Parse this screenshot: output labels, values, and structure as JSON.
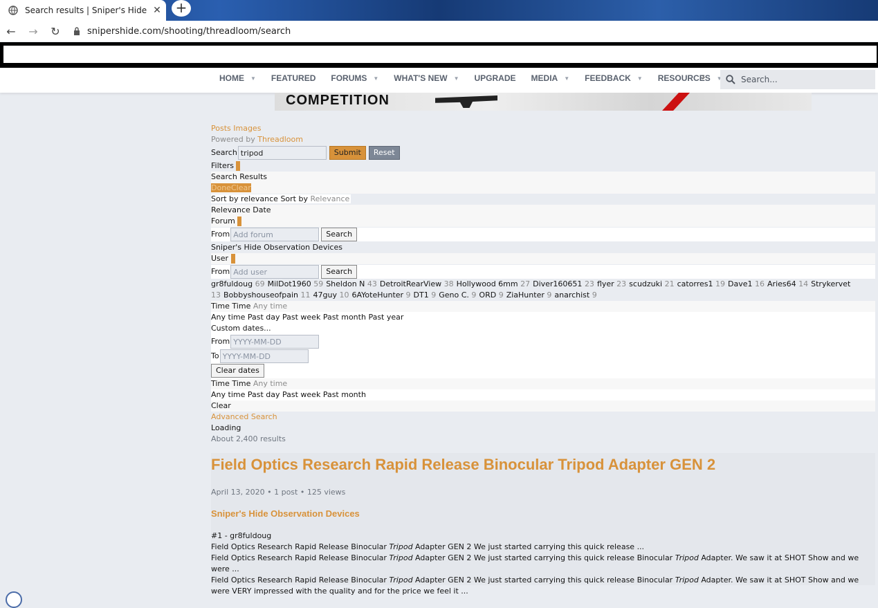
{
  "browser": {
    "tab_title": "Search results | Sniper's Hide For",
    "tab_close": "✕",
    "new_tab": "+",
    "url": "snipershide.com/shooting/threadloom/search"
  },
  "nav": {
    "items": [
      "HOME",
      "FEATURED",
      "FORUMS",
      "WHAT'S NEW",
      "UPGRADE",
      "MEDIA",
      "FEEDBACK",
      "RESOURCES"
    ],
    "more": "›",
    "search_placeholder": "Search..."
  },
  "banner": {
    "text": "COMPETITION"
  },
  "search": {
    "tabs": "Posts Images",
    "powered_prefix": "Powered by ",
    "powered_link": "Threadloom",
    "search_label": "Search",
    "query": "tripod",
    "submit": "Submit",
    "reset": "Reset",
    "filters": "Filters",
    "results_label": "Search Results",
    "done": "Done",
    "clear": "Clear",
    "sort_text": "Sort by relevance Sort by ",
    "sort_value": "Relevance",
    "sort_options": "Relevance Date",
    "forum_label": "Forum",
    "from_label": "From",
    "add_forum_placeholder": "Add forum",
    "search_btn": "Search",
    "forum_selected": "Sniper's Hide Observation Devices",
    "user_label": "User",
    "add_user_placeholder": "Add user",
    "users": [
      {
        "name": "gr8fuldoug",
        "count": "69"
      },
      {
        "name": "MilDot1960",
        "count": "59"
      },
      {
        "name": "Sheldon N",
        "count": "43"
      },
      {
        "name": "DetroitRearView",
        "count": "38"
      },
      {
        "name": "Hollywood 6mm",
        "count": "27"
      },
      {
        "name": "Diver160651",
        "count": "23"
      },
      {
        "name": "flyer",
        "count": "23"
      },
      {
        "name": "scudzuki",
        "count": "21"
      },
      {
        "name": "catorres1",
        "count": "19"
      },
      {
        "name": "Dave1",
        "count": "16"
      },
      {
        "name": "Aries64",
        "count": "14"
      },
      {
        "name": "Strykervet",
        "count": "13"
      },
      {
        "name": "Bobbyshouseofpain",
        "count": "11"
      },
      {
        "name": "47guy",
        "count": "10"
      },
      {
        "name": "6AYoteHunter",
        "count": "9"
      },
      {
        "name": "DT1",
        "count": "9"
      },
      {
        "name": "Geno C.",
        "count": "9"
      },
      {
        "name": "ORD",
        "count": "9"
      },
      {
        "name": "ZiaHunter",
        "count": "9"
      },
      {
        "name": "anarchist",
        "count": "9"
      }
    ],
    "time_label": "Time Time ",
    "time_value": "Any time",
    "time_options_1": "Any time Past day Past week Past month Past year",
    "custom_dates": "Custom dates...",
    "date_placeholder": "YYYY-MM-DD",
    "to_label": "To",
    "clear_dates": "Clear dates",
    "time_options_2": "Any time Past day Past week Past month",
    "clear2": "Clear",
    "advanced": "Advanced Search",
    "loading": "Loading",
    "count": "About 2,400 results"
  },
  "result": {
    "title": "Field Optics Research Rapid Release Binocular Tripod Adapter GEN 2",
    "meta": "April 13, 2020 • 1 post • 125 views",
    "forum": "Sniper's Hide Observation Devices",
    "post_num": "#1 - gr8fuldoug",
    "snippet_pre": "Field Optics Research Rapid Release Binocular ",
    "snippet_em": "Tripod",
    "snippet1_post": " Adapter GEN 2 We just started carrying this quick release ...",
    "snippet2_post": " Adapter GEN 2 We just started carrying this quick release Binocular ",
    "snippet2_end": " Adapter. We saw it at SHOT Show and we were ...",
    "snippet3_post": " Adapter GEN 2 We just started carrying this quick release Binocular ",
    "snippet3_end": " Adapter. We saw it at SHOT Show and we were VERY impressed with the quality and for the price we feel it ..."
  }
}
